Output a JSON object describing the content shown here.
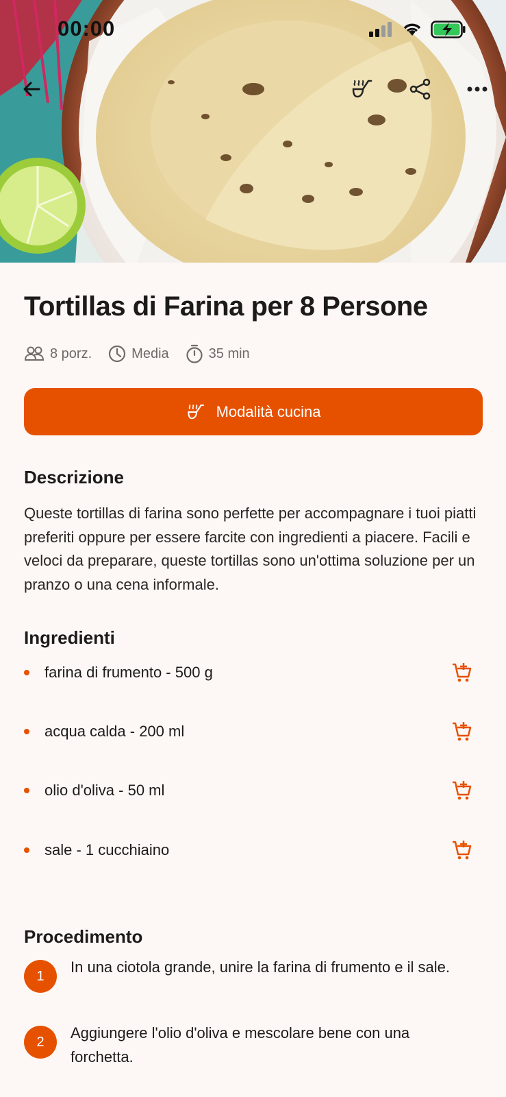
{
  "status_bar": {
    "time": "00:00"
  },
  "toolbar": {
    "back_icon": "arrow-left-icon",
    "cook_icon": "ladle-icon",
    "share_icon": "share-icon",
    "more_icon": "more-horizontal-icon"
  },
  "recipe": {
    "title": "Tortillas di Farina per 8 Persone",
    "servings": "8 porz.",
    "difficulty": "Media",
    "time": "35 min"
  },
  "cook_mode_button": {
    "label": "Modalità cucina"
  },
  "description": {
    "title": "Descrizione",
    "text": "Queste tortillas di farina sono perfette per accompagnare i tuoi piatti preferiti oppure per essere farcite con ingredienti a piacere. Facili e veloci da preparare, queste tortillas sono un'ottima soluzione per un pranzo o una cena informale."
  },
  "ingredients": {
    "title": "Ingredienti",
    "items": [
      {
        "label": "farina di frumento - 500 g"
      },
      {
        "label": "acqua calda - 200 ml"
      },
      {
        "label": "olio d'oliva - 50 ml"
      },
      {
        "label": "sale - 1 cucchiaino"
      }
    ]
  },
  "procedure": {
    "title": "Procedimento",
    "steps": [
      {
        "number": "1",
        "text": "In una ciotola grande, unire la farina di frumento e il sale."
      },
      {
        "number": "2",
        "text": "Aggiungere l'olio d'oliva e mescolare bene con una forchetta."
      }
    ]
  },
  "colors": {
    "accent": "#e65100",
    "background": "#fdf7f5"
  }
}
